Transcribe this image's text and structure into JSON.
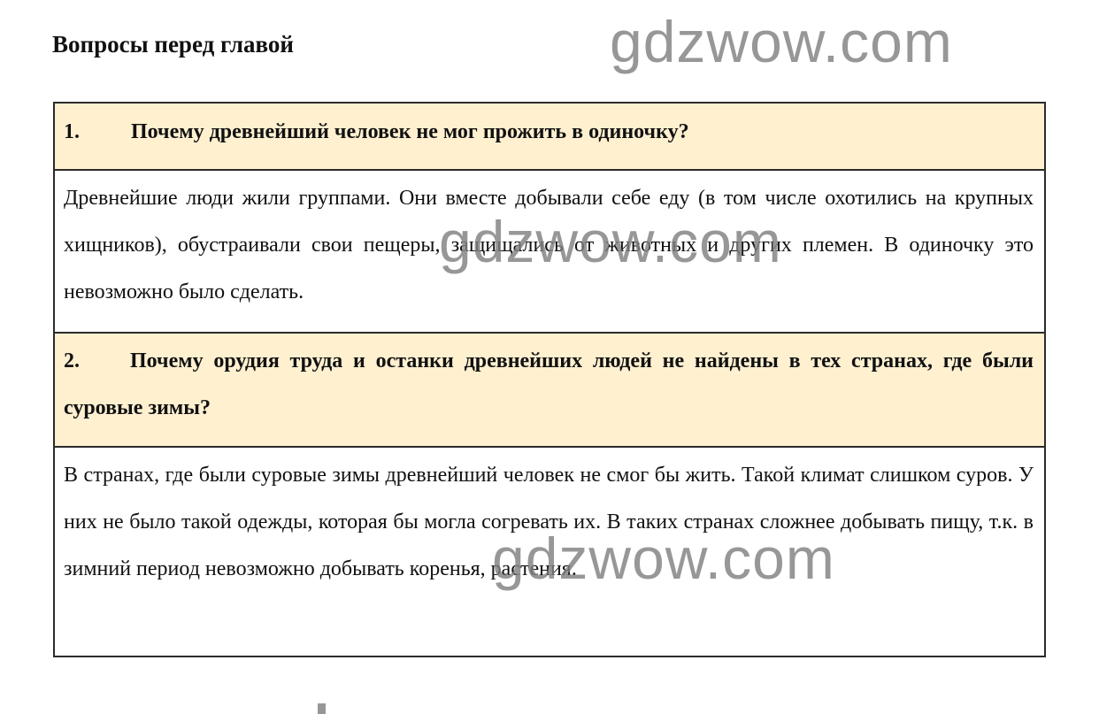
{
  "page": {
    "title": "Вопросы перед главой"
  },
  "watermark": {
    "text": "gdzwow.com"
  },
  "colors": {
    "question_background": "#fff0d0",
    "border": "#2b2b2b",
    "watermark": "#808080"
  },
  "questions": [
    {
      "number": "1.",
      "question": "Почему древнейший человек не мог прожить в одиночку?",
      "answer": "Древнейшие люди жили группами. Они вместе добывали себе еду (в том числе охотились на крупных хищников), обустраивали свои пещеры, защищались от животных и других племен. В одиночку это невозможно было сделать."
    },
    {
      "number": "2.",
      "question": "Почему орудия труда и останки древнейших людей не найдены в тех странах, где были суровые зимы?",
      "answer": "В странах, где были суровые зимы древнейший человек не смог бы жить. Такой климат слишком суров. У них не было такой одежды, которая бы могла согревать их. В таких странах сложнее добывать пищу, т.к. в зимний период невозможно добывать коренья, растения."
    }
  ]
}
